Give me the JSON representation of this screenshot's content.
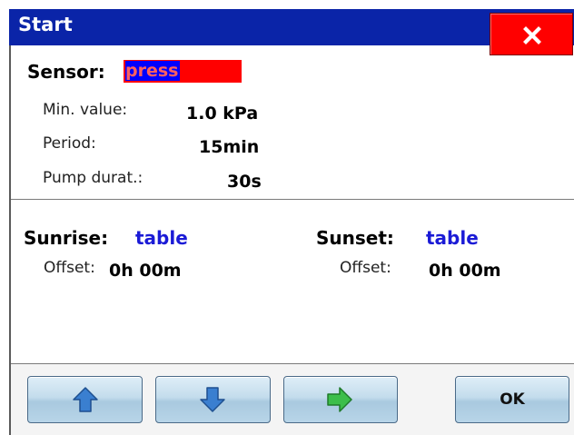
{
  "window": {
    "title": "Start",
    "close_icon": "close-icon",
    "colors": {
      "titlebar": "#0a24a8",
      "close_button": "#ff0000",
      "link": "#1b1bd6",
      "sensor_highlight": "#ff0000"
    }
  },
  "sensor": {
    "label": "Sensor:",
    "value": "press",
    "params": [
      {
        "label": "Min. value:",
        "value": "1.0 kPa"
      },
      {
        "label": "Period:",
        "value": "15min"
      },
      {
        "label": "Pump durat.:",
        "value": "30s"
      }
    ]
  },
  "sunrise": {
    "label": "Sunrise:",
    "value": "table",
    "offset_label": "Offset:",
    "offset_value": "0h 00m"
  },
  "sunset": {
    "label": "Sunset:",
    "value": "table",
    "offset_label": "Offset:",
    "offset_value": "0h 00m"
  },
  "toolbar": {
    "up_icon": "arrow-up-icon",
    "down_icon": "arrow-down-icon",
    "right_icon": "arrow-right-icon",
    "ok_label": "OK"
  }
}
